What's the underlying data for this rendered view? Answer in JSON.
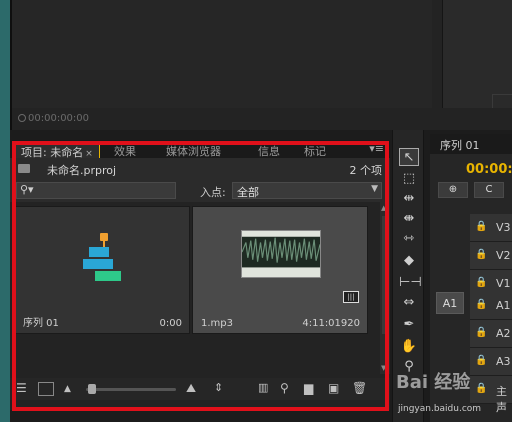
{
  "top_monitor": {
    "timecode": "00:00:00:00"
  },
  "project_panel": {
    "tabs": [
      {
        "label": "项目: 未命名",
        "close": "×"
      },
      {
        "label": "效果"
      },
      {
        "label": "媒体浏览器"
      },
      {
        "label": "信息"
      },
      {
        "label": "标记"
      }
    ],
    "panel_menu": "▾≡",
    "project_file": "未命名.prproj",
    "item_count": "2 个项",
    "search": {
      "icon": "magnifier-icon",
      "value": ""
    },
    "in_point_label": "入点:",
    "in_point_value": "全部",
    "items": [
      {
        "name": "序列 01",
        "duration": "0:00",
        "type": "sequence"
      },
      {
        "name": "1.mp3",
        "duration": "4:11:01920",
        "type": "audio"
      }
    ],
    "bottom_icons": [
      "list-view-icon",
      "icon-view-icon",
      "zoom-out-icon",
      "zoom-in-icon",
      "sort-icon",
      "automate-icon",
      "find-icon",
      "new-bin-icon",
      "new-item-icon",
      "clear-icon"
    ]
  },
  "tools": [
    "selection-tool-icon",
    "track-select-icon",
    "ripple-edit-icon",
    "rolling-edit-icon",
    "rate-stretch-icon",
    "razor-icon",
    "slip-icon",
    "slide-icon",
    "pen-icon",
    "hand-icon",
    "zoom-icon"
  ],
  "timeline": {
    "tab_label": "序列 01",
    "timecode": "00:00:",
    "tracks": [
      "V3",
      "V2",
      "V1",
      "A1",
      "A2",
      "A3",
      "主声"
    ],
    "source_patch": "A1"
  },
  "watermark": {
    "logo": "Bai 经验",
    "url": "jingyan.baidu.com"
  },
  "colors": {
    "accent": "#e8b400",
    "highlight": "#e0101a",
    "seq_blue": "#2aa7d6",
    "seq_green": "#2ec98a",
    "seq_orange": "#f0a030"
  }
}
